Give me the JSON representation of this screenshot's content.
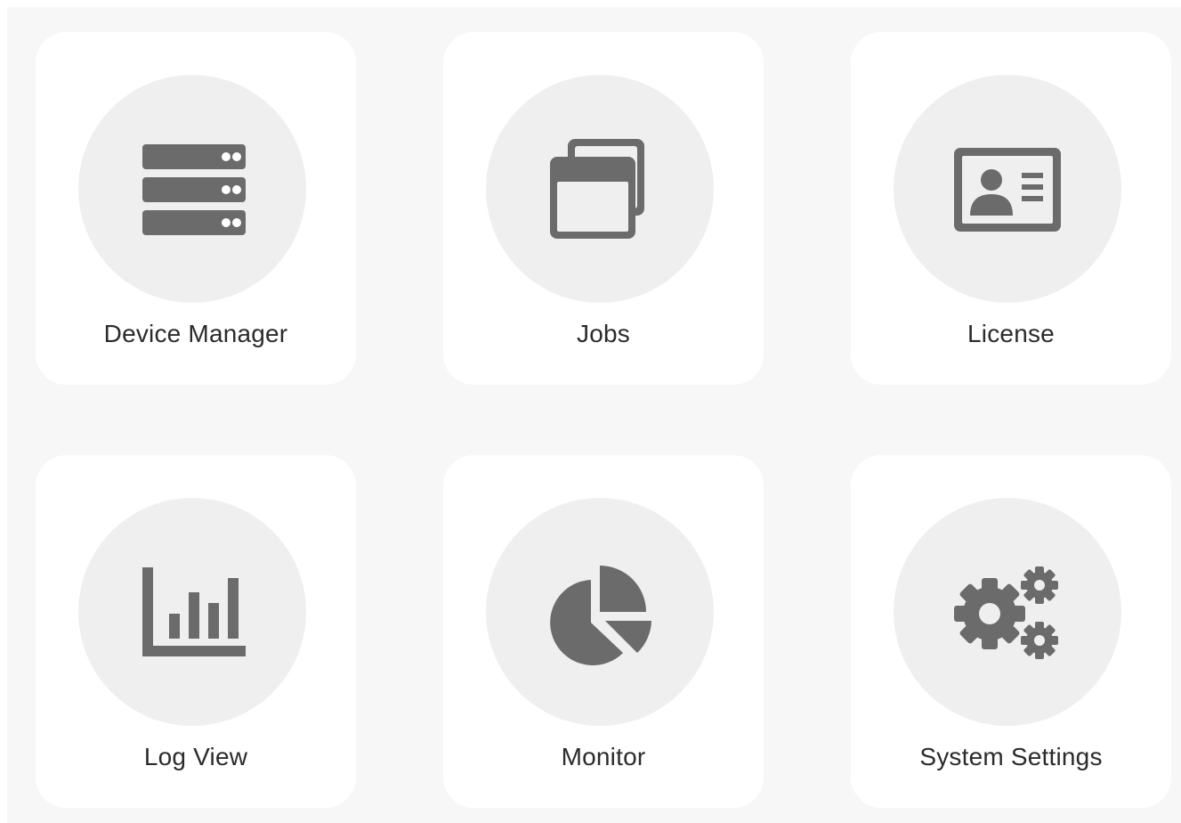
{
  "tiles": [
    {
      "label": "Device Manager",
      "icon": "server-stack-icon"
    },
    {
      "label": "Jobs",
      "icon": "windows-stack-icon"
    },
    {
      "label": "License",
      "icon": "id-card-icon"
    },
    {
      "label": "Log View",
      "icon": "bar-chart-icon"
    },
    {
      "label": "Monitor",
      "icon": "pie-chart-icon"
    },
    {
      "label": "System Settings",
      "icon": "gears-icon"
    }
  ],
  "colors": {
    "page_background": "#f7f7f7",
    "tile_background": "#ffffff",
    "icon_circle": "#efefef",
    "icon": "#6b6b6b",
    "label": "#2b2b2b"
  }
}
